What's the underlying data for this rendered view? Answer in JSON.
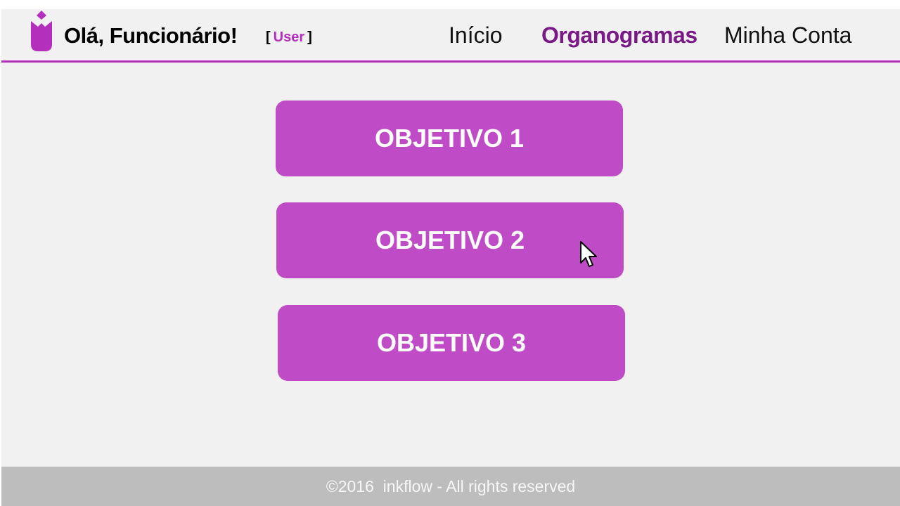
{
  "header": {
    "logo_icon": "tulip-logo-icon",
    "greeting": "Olá, Funcionário!",
    "role_open": "[",
    "role_name": "User",
    "role_close": "]",
    "nav": [
      {
        "label": "Início",
        "active": false
      },
      {
        "label": "Organogramas",
        "active": true
      },
      {
        "label": "Minha Conta",
        "active": false
      }
    ]
  },
  "main": {
    "objectives": [
      {
        "label": "OBJETIVO 1"
      },
      {
        "label": "OBJETIVO 2"
      },
      {
        "label": "OBJETIVO 3"
      }
    ]
  },
  "footer": {
    "text": "©2016  inkflow - All rights reserved"
  },
  "colors": {
    "accent": "#b52fbf",
    "button": "#c04bc6",
    "active_nav": "#7a1a86",
    "background": "#f1f1f1",
    "footer_bg": "#bdbdbd"
  }
}
